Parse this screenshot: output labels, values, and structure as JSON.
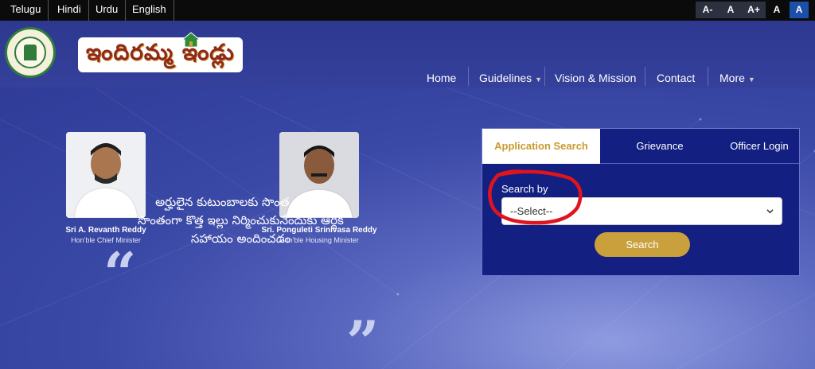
{
  "topbar": {
    "languages": [
      "Telugu",
      "Hindi",
      "Urdu",
      "English"
    ],
    "font_controls": [
      "A-",
      "A",
      "A+",
      "A",
      "A"
    ]
  },
  "header": {
    "logo_text": "ఇందిరమ్మ ఇండ్లు",
    "nav": {
      "home": "Home",
      "guidelines": "Guidelines",
      "vision": "Vision & Mission",
      "contact": "Contact",
      "more": "More"
    }
  },
  "leaders": [
    {
      "name": "Sri A. Revanth Reddy",
      "role": "Hon'ble Chief Minister"
    },
    {
      "name": "Sri. Ponguleti Srinivasa Reddy",
      "role": "Hon'ble Housing Minister"
    }
  ],
  "quote": {
    "open": "“",
    "close": "”",
    "line1": "అర్హులైన కుటుంబాలకు సొంత స్థలాల్లో",
    "line2": "సొంతంగా కొత్త ఇల్లు నిర్మించుకునేందుకు ఆర్థిక",
    "line3": "సహాయం అందించడం"
  },
  "panel": {
    "tabs": [
      "Application Search",
      "Grievance",
      "Officer Login"
    ],
    "search_by_label": "Search by",
    "select_value": "--Select--",
    "search_button": "Search"
  },
  "colors": {
    "accent_gold": "#c9a03c",
    "panel_blue": "#132082",
    "annotation_red": "#e0141c"
  }
}
